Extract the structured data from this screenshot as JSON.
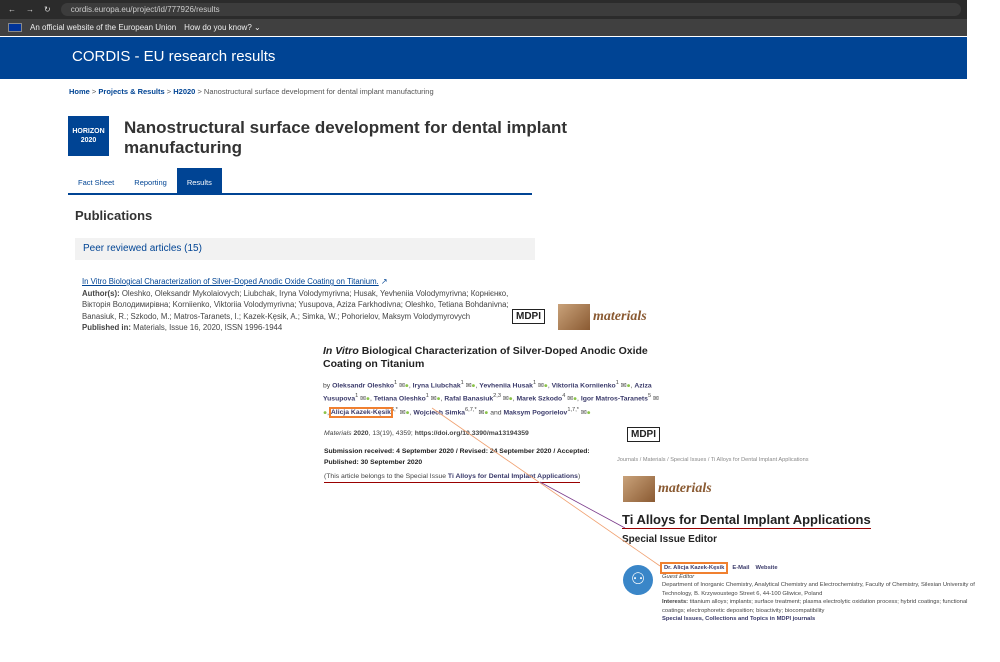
{
  "browser": {
    "url": "cordis.europa.eu/project/id/777926/results"
  },
  "eu_bar": {
    "text": "An official website of the European Union",
    "how": "How do you know? ⌄"
  },
  "header": {
    "title": "CORDIS - EU research results"
  },
  "breadcrumb": [
    "Home",
    "Projects & Results",
    "H2020",
    "Nanostructural surface development for dental implant manufacturing"
  ],
  "program_logo": {
    "line1": "HORIZON",
    "line2": "2020"
  },
  "page_title": "Nanostructural surface development for dental implant manufacturing",
  "tabs": [
    {
      "label": "Fact Sheet"
    },
    {
      "label": "Reporting"
    },
    {
      "label": "Results",
      "active": true
    }
  ],
  "publications": {
    "heading": "Publications",
    "section": "Peer reviewed articles (15)",
    "item": {
      "title": "In Vitro Biological Characterization of Silver-Doped Anodic Oxide Coating on Titanium.",
      "authors_label": "Author(s):",
      "authors": "Oleshko, Oleksandr Mykolaiovych; Liubchak, Iryna Volodymyrivna; Husak, Yevheniia Volodymyrivna; Корнієнко, Вікторія Володимирівна; Korniienko, Viktoriia Volodymyrivna; Yusupova, Aziza Farkhodivna; Oleshko, Tetiana Bohdanivna; Banasiuk, R.; Szkodo, M.; Matros-Taranets, I.; Kazek-Kęsik, A.; Simka, W.; Pohorielov, Maksym Volodymyrovych",
      "published_label": "Published in:",
      "published": "Materials, Issue 16, 2020, ISSN 1996-1944"
    }
  },
  "mdpi_article": {
    "publisher": "MDPI",
    "journal": "materials",
    "title_italic": "In Vitro",
    "title_rest": " Biological Characterization of Silver-Doped Anodic Oxide Coating on Titanium",
    "by": "by",
    "authors": [
      {
        "name": "Oleksandr Oleshko",
        "sup": "1"
      },
      {
        "name": "Iryna Liubchak",
        "sup": "1"
      },
      {
        "name": "Yevheniia Husak",
        "sup": "1"
      },
      {
        "name": "Viktoriia Korniienko",
        "sup": "1"
      },
      {
        "name": "Aziza Yusupova",
        "sup": "1"
      },
      {
        "name": "Tetiana Oleshko",
        "sup": "1"
      },
      {
        "name": "Rafal Banasiuk",
        "sup": "2,3"
      },
      {
        "name": "Marek Szkodo",
        "sup": "4"
      },
      {
        "name": "Igor Matros-Taranets",
        "sup": "5"
      },
      {
        "name": "Alicja Kazek-Kęsik",
        "sup": "6,*",
        "highlight": true
      },
      {
        "name": "Wojciech Simka",
        "sup": "6,7,*"
      },
      {
        "name": "Maksym Pogorielov",
        "sup": "1,7,*"
      }
    ],
    "and": "and",
    "cite_journal": "Materials",
    "cite_year": "2020",
    "cite_rest": ", 13(19), 4359;",
    "doi": "https://doi.org/10.3390/ma13194359",
    "dates": "Submission received: 4 September 2020 / Revised: 24 September 2020 / Accepted: Published: 30 September 2020",
    "belongs_prefix": "(This article belongs to the Special Issue ",
    "belongs_link": "Ti Alloys for Dental Implant Applications",
    "belongs_suffix": ")"
  },
  "special_issue": {
    "publisher": "MDPI",
    "breadcrumb": [
      "Journals",
      "Materials",
      "Special Issues",
      "Ti Alloys for Dental Implant Applications"
    ],
    "journal": "materials",
    "title": "Ti Alloys for Dental Implant Applications",
    "editor_heading": "Special Issue Editor",
    "editor": {
      "name": "Dr. Alicja Kazek-Kęsik",
      "email": "E-Mail",
      "website": "Website",
      "role": "Guest Editor",
      "affiliation": "Department of Inorganic Chemistry, Analytical Chemistry and Electrochemistry, Faculty of Chemistry, Silesian University of Technology, B. Krzywoustego Street 6, 44-100 Gliwice, Poland",
      "interests_label": "Interests:",
      "interests": "titanium alloys; implants; surface treatment; plasma electrolytic oxidation process; hybrid coatings; functional coatings; electrophoretic deposition; bioactivity; biocompatibility",
      "more": "Special Issues, Collections and Topics in MDPI journals"
    }
  },
  "colors": {
    "cordis_blue": "#004494",
    "highlight": "#f08030",
    "connector_purple": "#7a3a8a",
    "underline_red": "#990000"
  }
}
